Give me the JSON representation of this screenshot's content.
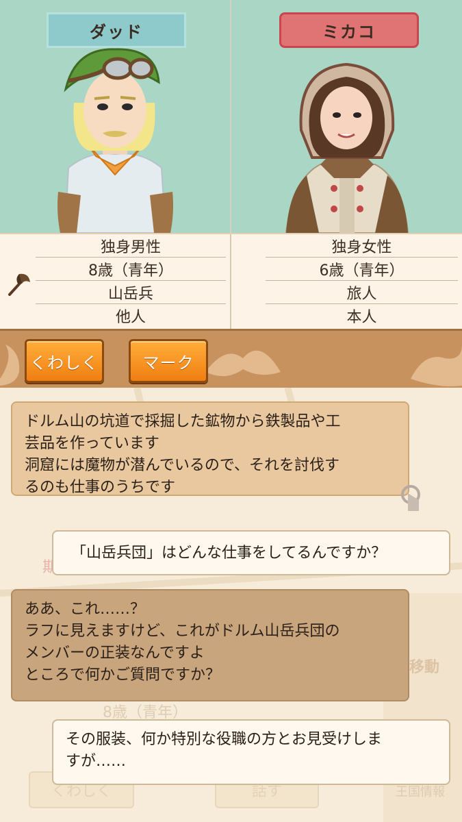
{
  "characters": {
    "left": {
      "name": "ダッド",
      "status": "独身男性",
      "age": "8歳（青年）",
      "job": "山岳兵",
      "relation": "他人"
    },
    "right": {
      "name": "ミカコ",
      "status": "独身女性",
      "age": "6歳（青年）",
      "job": "旅人",
      "relation": "本人"
    }
  },
  "toolbar": {
    "details_label": "くわしく",
    "mark_label": "マーク"
  },
  "chat": {
    "npc_1": [
      "ドルム山の坑道で採掘した鉱物から鉄製品や工",
      "芸品を作っています",
      "洞窟には魔物が潜んでいるので、それを討伐す",
      "るのも仕事のうちです"
    ],
    "player_1": [
      "「山岳兵団」はどんな仕事をしてるんですか？"
    ],
    "npc_2": [
      "ああ、これ……？",
      "ラフに見えますけど、これがドルム山岳兵団の",
      "メンバーの正装なんですよ",
      "ところで何かご質問ですか？"
    ],
    "player_2": [
      "その服装、何か特別な役職の方とお見受けしま",
      "すが……"
    ]
  },
  "background_ghost": {
    "limited": "期間限定",
    "age_hint": "8歳（青年）",
    "move": "移動",
    "details": "くわしく",
    "talk": "話す",
    "kingdom_info": "王国情報"
  },
  "colors": {
    "portrait_bg": "#a9d6c5",
    "male_tag": "#8ec9cb",
    "female_tag": "#e07474",
    "toolbar": "#c7925e",
    "button": "#f07e12",
    "npc_bubble": "#e9c8a0",
    "player_bubble": "#fff8ee"
  }
}
